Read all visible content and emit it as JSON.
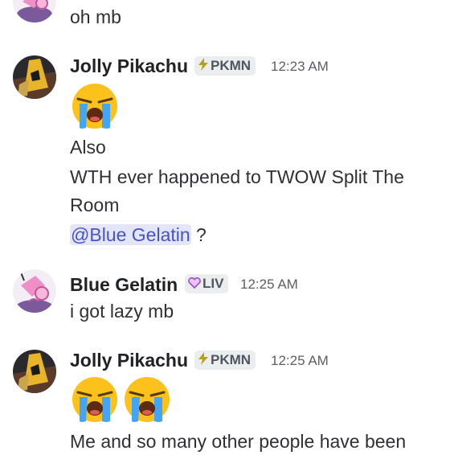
{
  "messages": [
    {
      "text": "oh mb"
    },
    {
      "author": "Jolly Pikachu",
      "tag": "PKMN",
      "time": "12:23 AM",
      "lines": [
        "Also",
        "WTH ever happened to TWOW Split The",
        "Room"
      ],
      "mention": "@Blue Gelatin",
      "mention_suffix": " ?"
    },
    {
      "author": "Blue Gelatin",
      "tag": "LIV",
      "time": "12:25 AM",
      "lines": [
        "i got lazy mb"
      ]
    },
    {
      "author": "Jolly Pikachu",
      "tag": "PKMN",
      "time": "12:25 AM",
      "lines": [
        "Me and so many other people have been"
      ]
    }
  ],
  "icons": {
    "pkmn_tag": "lightning-bolt-icon",
    "liv_tag": "heart-icon",
    "emoji": "loudly-crying-face-emoji"
  },
  "colors": {
    "mention_bg": "#e3e6fb",
    "mention_text": "#4752c4",
    "tag_bg": "#ebedef"
  }
}
